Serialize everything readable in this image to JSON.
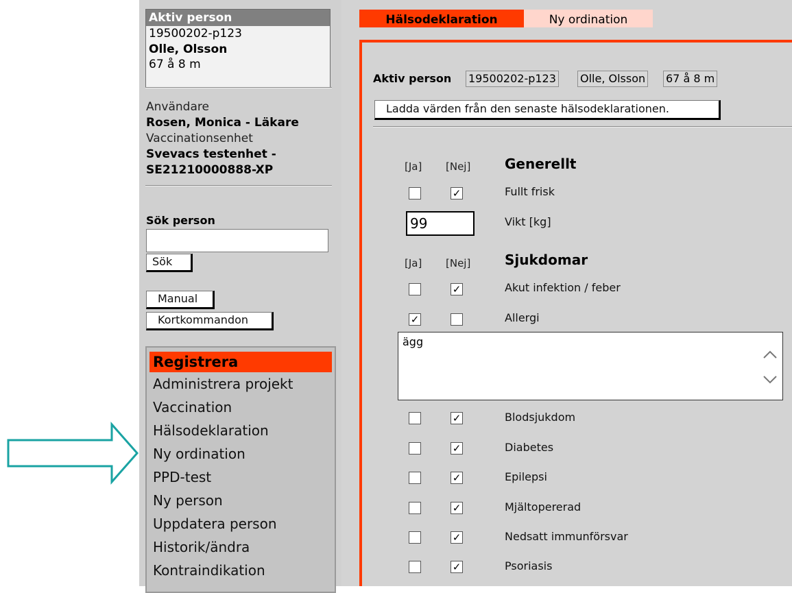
{
  "active_person": {
    "heading": "Aktiv person",
    "id": "19500202-p123",
    "name": "Olle, Olsson",
    "age": "67 å 8 m"
  },
  "user": {
    "user_label": "Användare",
    "user_name": "Rosen, Monica - Läkare",
    "unit_label": "Vaccinationsenhet",
    "unit_name_1": "Svevacs testenhet -",
    "unit_name_2": "SE21210000888-XP"
  },
  "search": {
    "label": "Sök person",
    "value": "",
    "button": "Sök"
  },
  "buttons": {
    "manual": "Manual",
    "shortcuts": "Kortkommandon"
  },
  "menu": {
    "active": "Registrera",
    "items": [
      "Administrera projekt",
      "Vaccination",
      "Hälsodeklaration",
      "Ny ordination",
      "PPD-test",
      "Ny person",
      "Uppdatera person",
      "Historik/ändra",
      "Kontraindikation"
    ]
  },
  "tabs": {
    "active": "Hälsodeklaration",
    "other": "Ny ordination"
  },
  "form": {
    "person_label": "Aktiv person",
    "person_id": "19500202-p123",
    "person_name": "Olle, Olsson",
    "person_age": "67 å 8 m",
    "load_button": "Ladda värden från den senaste hälsodeklarationen.",
    "yes_header": "[Ja]",
    "no_header": "[Nej]",
    "section_general": "Generellt",
    "section_diseases": "Sjukdomar",
    "general_q1": "Fullt frisk",
    "weight_label": "Vikt [kg]",
    "weight_value": "99",
    "allergy_text": "ägg",
    "questions": [
      {
        "label": "Akut infektion / feber",
        "answer": "nej"
      },
      {
        "label": "Allergi",
        "answer": "ja"
      },
      {
        "label": "Blodsjukdom",
        "answer": "nej"
      },
      {
        "label": "Diabetes",
        "answer": "nej"
      },
      {
        "label": "Epilepsi",
        "answer": "nej"
      },
      {
        "label": "Mjältopererad",
        "answer": "nej"
      },
      {
        "label": "Nedsatt immunförsvar",
        "answer": "nej"
      },
      {
        "label": "Psoriasis",
        "answer": "nej"
      }
    ],
    "check_mark": "✓"
  },
  "colors": {
    "accent": "#ff3a00",
    "accent_light": "#ffd6cc",
    "arrow": "#1aa3a3"
  }
}
